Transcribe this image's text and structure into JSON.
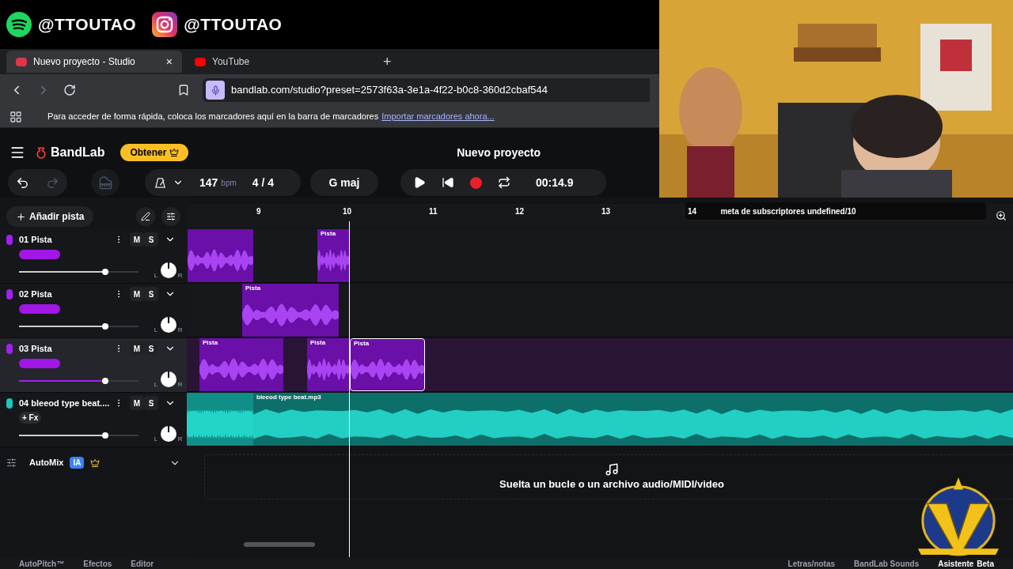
{
  "overlay": {
    "socials": [
      {
        "kind": "spotify",
        "handle": "@TTOUTAO"
      },
      {
        "kind": "instagram",
        "handle": "@TTOUTAO"
      }
    ],
    "goal": "meta de subscriptores undefined/10"
  },
  "browser": {
    "tabs": [
      {
        "title": "Nuevo proyecto - Studio",
        "selected": true,
        "close": "×"
      },
      {
        "title": "YouTube",
        "selected": false
      }
    ],
    "new_tab": "+",
    "url": "bandlab.com/studio?preset=2573f63a-3e1a-4f22-b0c8-360d2cbaf544",
    "bookmarks_hint": "Para acceder de forma rápida, coloca los marcadores aquí en la barra de marcadores",
    "bookmarks_link": "Importar marcadores ahora..."
  },
  "app": {
    "logo": "BandLab",
    "get_button": "Obtener",
    "project_title": "Nuevo proyecto",
    "tempo": "147",
    "tempo_unit": "bpm",
    "time_signature": "4 / 4",
    "key": "G maj",
    "time": "00:14.9",
    "add_track": "Añadir pista"
  },
  "ruler": [
    "9",
    "10",
    "11",
    "12",
    "13",
    "14"
  ],
  "tracks": [
    {
      "number": "01",
      "name": "Pista",
      "color": "#a020f0",
      "selected": false,
      "level": 0.72,
      "mute": "M",
      "solo": "S",
      "pan_left": "L",
      "pan_right": "R",
      "clips": [
        {
          "selected": false
        },
        {
          "label": "Pista",
          "selected": false
        }
      ]
    },
    {
      "number": "02",
      "name": "Pista",
      "color": "#a020f0",
      "selected": false,
      "level": 0.72,
      "mute": "M",
      "solo": "S",
      "pan_left": "L",
      "pan_right": "R",
      "clips": [
        {
          "label": "Pista",
          "selected": false
        }
      ]
    },
    {
      "number": "03",
      "name": "Pista",
      "color": "#a020f0",
      "selected": true,
      "level": 0.72,
      "mute": "M",
      "solo": "S",
      "pan_left": "L",
      "pan_right": "R",
      "clips": [
        {
          "label": "Pista",
          "selected": false
        },
        {
          "label": "Pista",
          "selected": false
        },
        {
          "label": "Pista",
          "selected": true
        }
      ]
    },
    {
      "number": "04",
      "name": "bleeod type beat....",
      "color": "#19c9bd",
      "selected": false,
      "level": 0.72,
      "fx": "+ Fx",
      "mute": "M",
      "solo": "S",
      "pan_left": "L",
      "pan_right": "R",
      "clips": [
        {
          "selected": false
        },
        {
          "label": "bleeod type beat.mp3",
          "selected": false
        }
      ]
    }
  ],
  "automix": {
    "label": "AutoMix",
    "badge": "IA"
  },
  "drop_zone": "Suelta un bucle o un archivo audio/MIDI/video",
  "bottom_bar": {
    "left": [
      "AutoPitch™",
      "Efectos",
      "Editor"
    ],
    "right": [
      "Letras/notas",
      "BandLab Sounds"
    ],
    "assistant": "Asistente",
    "assistant_badge": "Beta"
  }
}
